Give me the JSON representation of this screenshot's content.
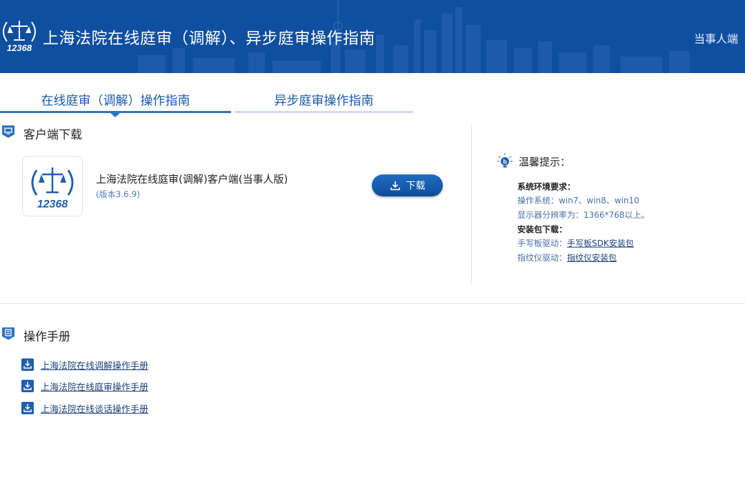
{
  "header": {
    "title": "上海法院在线庭审（调解）、异步庭审操作指南",
    "role": "当事人端",
    "logo_text": "12368"
  },
  "tabs": [
    {
      "label": "在线庭审（调解）操作指南",
      "active": true
    },
    {
      "label": "异步庭审操作指南",
      "active": false
    }
  ],
  "client_section": {
    "title": "客户端下载",
    "app_name": "上海法院在线庭审(调解)客户端(当事人版)",
    "version": "(版本3.6.9)",
    "download_label": "下载"
  },
  "tips": {
    "title": "温馨提示：",
    "env_heading": "系统环境要求：",
    "os_line": "操作系统：win7、win8、win10",
    "resolution_line": "显示器分辨率为：1366*768以上。",
    "pkg_heading": "安装包下载：",
    "tablet_label": "手写板驱动：",
    "tablet_link": "手写板SDK安装包",
    "finger_label": "指纹仪驱动：",
    "finger_link": "指纹仪安装包"
  },
  "manual_section": {
    "title": "操作手册",
    "items": [
      {
        "label": "上海法院在线调解操作手册"
      },
      {
        "label": "上海法院在线庭审操作手册"
      },
      {
        "label": "上海法院在线谈话操作手册"
      }
    ]
  },
  "colors": {
    "header_bg": "#0f4fa0",
    "accent": "#2e73c0",
    "link": "#1c3f7a"
  }
}
